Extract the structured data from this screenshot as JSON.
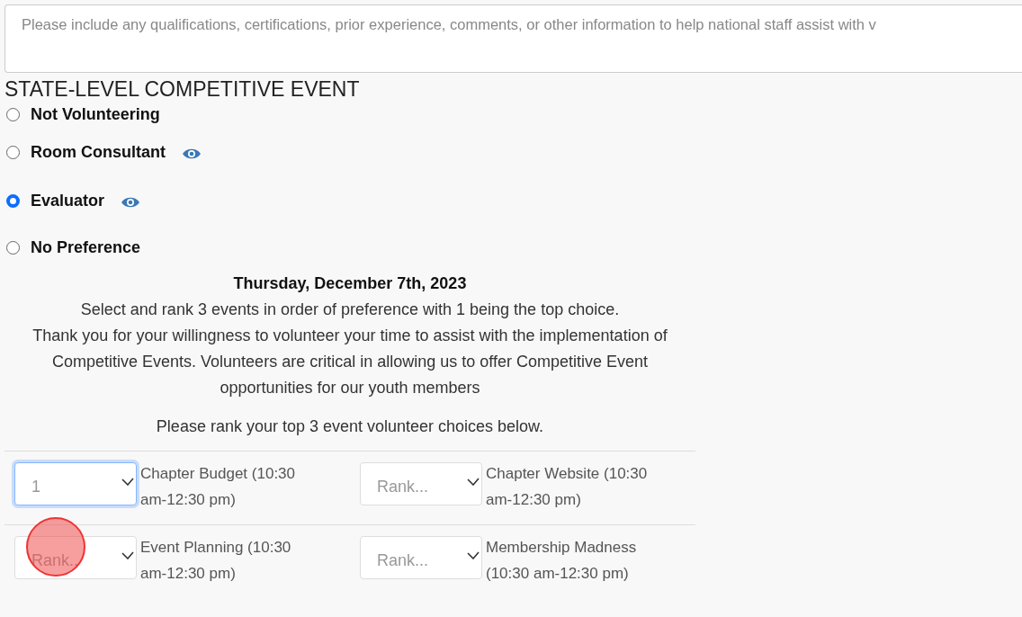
{
  "comments": {
    "placeholder": "Please include any qualifications, certifications, prior experience, comments, or other information to help national staff assist with v"
  },
  "section": {
    "title": "STATE-LEVEL COMPETITIVE EVENT",
    "roles": [
      {
        "label": "Not Volunteering",
        "selected": false,
        "info": false
      },
      {
        "label": "Room Consultant",
        "selected": false,
        "info": true
      },
      {
        "label": "Evaluator",
        "selected": true,
        "info": true
      },
      {
        "label": "No Preference",
        "selected": false,
        "info": false
      }
    ]
  },
  "day": {
    "date": "Thursday, December 7th, 2023",
    "instructions": "Select and rank 3 events in order of preference with 1 being the top choice.",
    "thanks": "Thank you for your willingness to volunteer your time to assist with the implementation of Competitive Events. Volunteers are critical in allowing us to offer Competitive Event opportunities for our youth members",
    "prompt": "Please rank your top 3 event volunteer choices below.",
    "events": [
      {
        "rank": "1",
        "focused": true,
        "name": "Chapter Budget (10:30 am-12:30 pm)"
      },
      {
        "placeholder": "Rank...",
        "focused": false,
        "name": "Chapter Website (10:30 am-12:30 pm)"
      },
      {
        "placeholder": "Rank..",
        "focused": false,
        "name": "Event Planning (10:30 am-12:30 pm)"
      },
      {
        "placeholder": "Rank...",
        "focused": false,
        "name": "Membership Madness (10:30 am-12:30 pm)"
      }
    ]
  }
}
